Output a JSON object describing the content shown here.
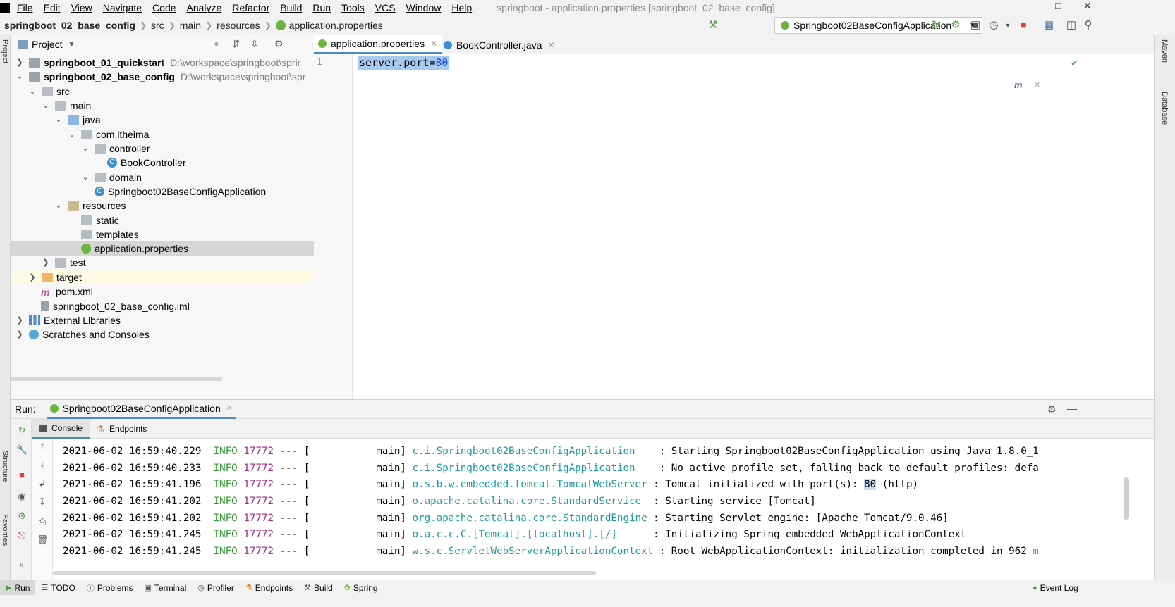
{
  "window": {
    "title": "springboot - application.properties [springboot_02_base_config]"
  },
  "menu": [
    "File",
    "Edit",
    "View",
    "Navigate",
    "Code",
    "Analyze",
    "Refactor",
    "Build",
    "Run",
    "Tools",
    "VCS",
    "Window",
    "Help"
  ],
  "breadcrumb": [
    "springboot_02_base_config",
    "src",
    "main",
    "resources",
    "application.properties"
  ],
  "run_config": {
    "label": "Springboot02BaseConfigApplication"
  },
  "project_panel": {
    "title": "Project",
    "tree": [
      {
        "label": "springboot_01_quickstart",
        "path": "D:\\workspace\\springboot\\sprir"
      },
      {
        "label": "springboot_02_base_config",
        "path": "D:\\workspace\\springboot\\spr"
      },
      {
        "label": "src"
      },
      {
        "label": "main"
      },
      {
        "label": "java"
      },
      {
        "label": "com.itheima"
      },
      {
        "label": "controller"
      },
      {
        "label": "BookController"
      },
      {
        "label": "domain"
      },
      {
        "label": "Springboot02BaseConfigApplication"
      },
      {
        "label": "resources"
      },
      {
        "label": "static"
      },
      {
        "label": "templates"
      },
      {
        "label": "application.properties"
      },
      {
        "label": "test"
      },
      {
        "label": "target"
      },
      {
        "label": "pom.xml"
      },
      {
        "label": "springboot_02_base_config.iml"
      },
      {
        "label": "External Libraries"
      },
      {
        "label": "Scratches and Consoles"
      }
    ]
  },
  "editor": {
    "tabs": [
      "application.properties",
      "BookController.java"
    ],
    "line_number": "1",
    "code_key": "server.port=",
    "code_value": "80"
  },
  "run_panel": {
    "label": "Run:",
    "app_tab": "Springboot02BaseConfigApplication",
    "subtabs": [
      "Console",
      "Endpoints"
    ],
    "log": [
      {
        "ts": "2021-06-02 16:59:40.229",
        "level": "INFO",
        "pid": "17772",
        "sep": "--- [",
        "thread": "main]",
        "cls": "c.i.Springboot02BaseConfigApplication",
        "msg": ": Starting Springboot02BaseConfigApplication using Java 1.8.0_1"
      },
      {
        "ts": "2021-06-02 16:59:40.233",
        "level": "INFO",
        "pid": "17772",
        "sep": "--- [",
        "thread": "main]",
        "cls": "c.i.Springboot02BaseConfigApplication",
        "msg": ": No active profile set, falling back to default profiles: defa"
      },
      {
        "ts": "2021-06-02 16:59:41.196",
        "level": "INFO",
        "pid": "17772",
        "sep": "--- [",
        "thread": "main]",
        "cls": "o.s.b.w.embedded.tomcat.TomcatWebServer",
        "msg": ": Tomcat initialized with port(s): ",
        "hl": "80",
        "tail": " (http)"
      },
      {
        "ts": "2021-06-02 16:59:41.202",
        "level": "INFO",
        "pid": "17772",
        "sep": "--- [",
        "thread": "main]",
        "cls": "o.apache.catalina.core.StandardService",
        "msg": ": Starting service [Tomcat]"
      },
      {
        "ts": "2021-06-02 16:59:41.202",
        "level": "INFO",
        "pid": "17772",
        "sep": "--- [",
        "thread": "main]",
        "cls": "org.apache.catalina.core.StandardEngine",
        "msg": ": Starting Servlet engine: [Apache Tomcat/9.0.46]"
      },
      {
        "ts": "2021-06-02 16:59:41.245",
        "level": "INFO",
        "pid": "17772",
        "sep": "--- [",
        "thread": "main]",
        "cls": "o.a.c.c.C.[Tomcat].[localhost].[/]",
        "msg": ": Initializing Spring embedded WebApplicationContext"
      },
      {
        "ts": "2021-06-02 16:59:41.245",
        "level": "INFO",
        "pid": "17772",
        "sep": "--- [",
        "thread": "main]",
        "cls": "w.s.c.ServletWebServerApplicationContext",
        "msg": ": Root WebApplicationContext: initialization completed in 962 m"
      }
    ]
  },
  "side_labels": {
    "project": "Project",
    "structure": "Structure",
    "favorites": "Favorites",
    "maven": "Maven",
    "database": "Database"
  },
  "bottom_tabs": [
    "Run",
    "TODO",
    "Problems",
    "Terminal",
    "Profiler",
    "Endpoints",
    "Build",
    "Spring"
  ],
  "event_log": "Event Log"
}
